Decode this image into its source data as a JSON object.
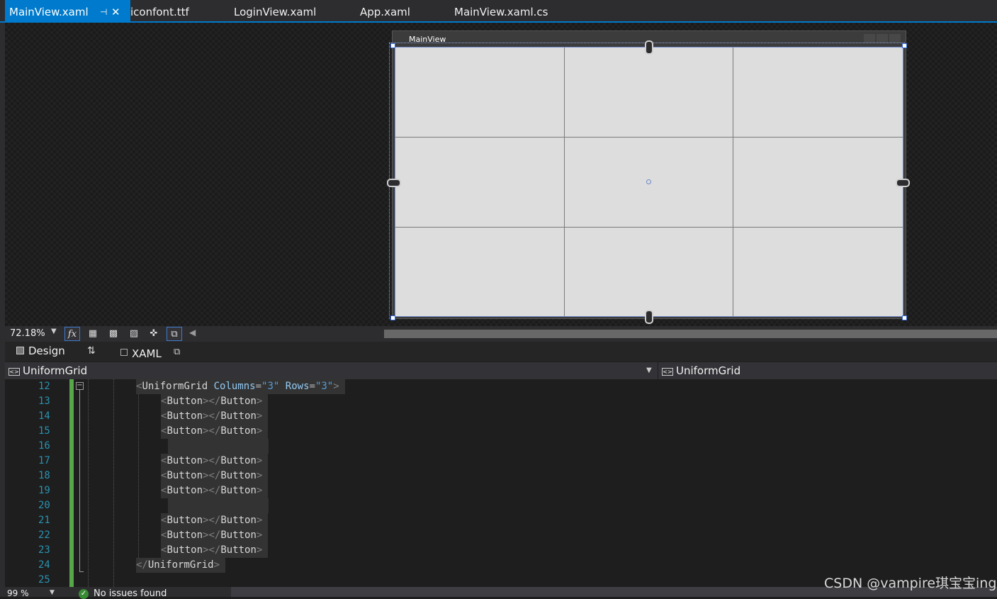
{
  "tabs": [
    {
      "label": "MainView.xaml",
      "active": true
    },
    {
      "label": "iconfont.ttf"
    },
    {
      "label": "LoginView.xaml"
    },
    {
      "label": "App.xaml"
    },
    {
      "label": "MainView.xaml.cs"
    }
  ],
  "tab_pin_glyph": "⊣",
  "tab_close_glyph": "✕",
  "designer": {
    "window_title": "MainView",
    "grid": {
      "columns": 3,
      "rows": 3
    }
  },
  "zoom": {
    "value": "72.18%",
    "fx_label": "fx"
  },
  "views": {
    "design_label": "Design",
    "xaml_label": "XAML",
    "swap_glyph": "⇅",
    "popout_glyph": "⧉"
  },
  "nav": {
    "left": "UniformGrid",
    "right": "UniformGrid"
  },
  "code": {
    "lines": [
      {
        "n": "12",
        "indent": 0,
        "kind": "open"
      },
      {
        "n": "13",
        "indent": 1,
        "kind": "button"
      },
      {
        "n": "14",
        "indent": 1,
        "kind": "button"
      },
      {
        "n": "15",
        "indent": 1,
        "kind": "button"
      },
      {
        "n": "16",
        "indent": 1,
        "kind": "blank"
      },
      {
        "n": "17",
        "indent": 1,
        "kind": "button"
      },
      {
        "n": "18",
        "indent": 1,
        "kind": "button"
      },
      {
        "n": "19",
        "indent": 1,
        "kind": "button"
      },
      {
        "n": "20",
        "indent": 1,
        "kind": "blank"
      },
      {
        "n": "21",
        "indent": 1,
        "kind": "button"
      },
      {
        "n": "22",
        "indent": 1,
        "kind": "button"
      },
      {
        "n": "23",
        "indent": 1,
        "kind": "button"
      },
      {
        "n": "24",
        "indent": 0,
        "kind": "close"
      },
      {
        "n": "25",
        "indent": 0,
        "kind": "empty"
      }
    ],
    "tokens": {
      "lt": "<",
      "lt_slash": "</",
      "gt": ">",
      "uniform_grid": "UniformGrid",
      "button": "Button",
      "attr_columns": "Columns",
      "attr_rows": "Rows",
      "eq": "=",
      "val_columns": "\"3\"",
      "val_rows": "\"3\""
    }
  },
  "status": {
    "zoom": "99 %",
    "message": "No issues found",
    "ok_glyph": "✓"
  },
  "watermark": "CSDN @vampire琪宝宝ing",
  "colors": {
    "accent": "#007acc",
    "line_number": "#2b91af",
    "attribute": "#92caf4",
    "value": "#569cd6",
    "change_bar": "#57a64a"
  }
}
